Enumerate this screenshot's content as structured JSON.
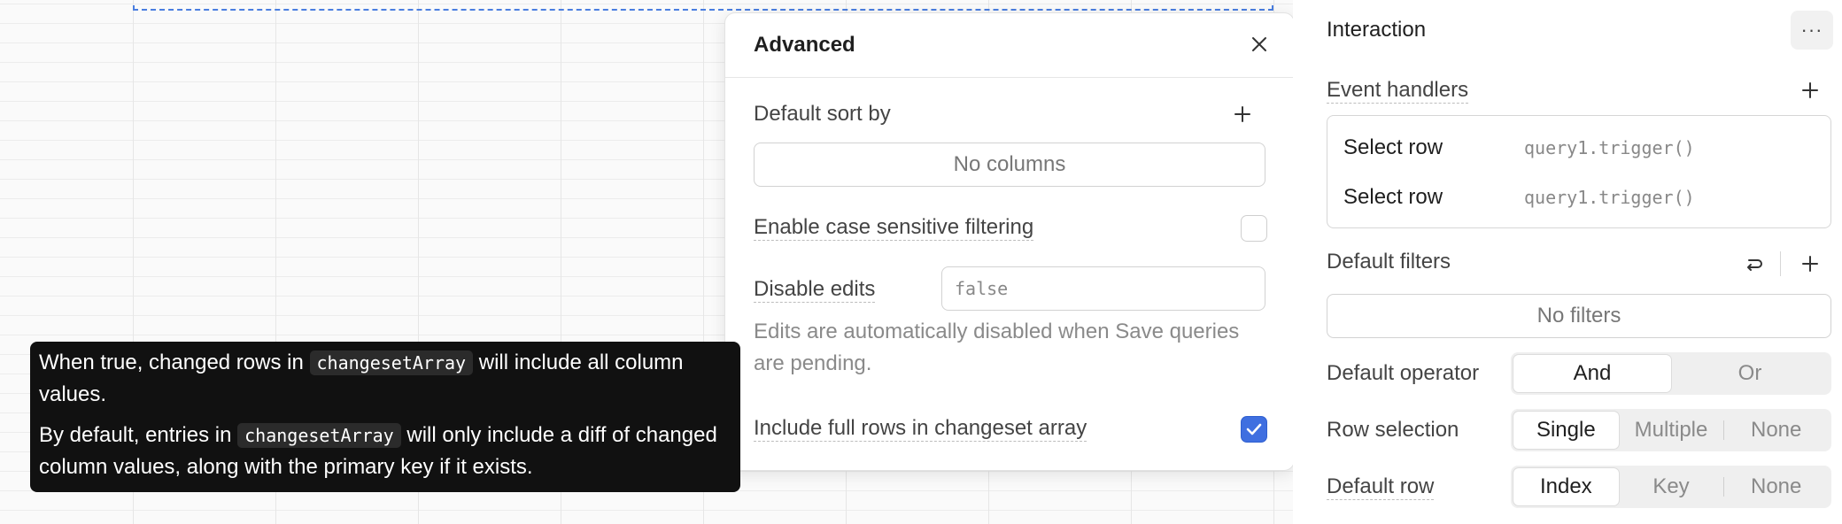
{
  "advanced": {
    "title": "Advanced",
    "default_sort_label": "Default sort by",
    "no_columns": "No columns",
    "case_sensitive_label": "Enable case sensitive filtering",
    "case_sensitive_checked": false,
    "disable_edits_label": "Disable edits",
    "disable_edits_value": "false",
    "disable_edits_helper": "Edits are automatically disabled when Save queries are pending.",
    "full_rows_label": "Include full rows in changeset array",
    "full_rows_checked": true
  },
  "tooltip": {
    "p1_before": "When true, changed rows in ",
    "p1_code": "changesetArray",
    "p1_after": " will include all column values.",
    "p2_before": "By default, entries in ",
    "p2_code": "changesetArray",
    "p2_after": " will only include a diff of changed column values, along with the primary key if it exists."
  },
  "inspector": {
    "title": "Interaction",
    "more": "···",
    "event_handlers_label": "Event handlers",
    "event_handlers": [
      {
        "event": "Select row",
        "action": "query1.trigger()"
      },
      {
        "event": "Select row",
        "action": "query1.trigger()"
      }
    ],
    "default_filters_label": "Default filters",
    "no_filters": "No filters",
    "default_operator_label": "Default operator",
    "operator_options": [
      "And",
      "Or"
    ],
    "operator_selected": "And",
    "row_selection_label": "Row selection",
    "row_selection_options": [
      "Single",
      "Multiple",
      "None"
    ],
    "row_selection_selected": "Single",
    "default_row_label": "Default row",
    "default_row_options": [
      "Index",
      "Key",
      "None"
    ],
    "default_row_selected": "Index"
  },
  "colors": {
    "accent": "#3f6fe0",
    "tooltip_bg": "#111111",
    "selection_outline": "#4a7ee0"
  }
}
